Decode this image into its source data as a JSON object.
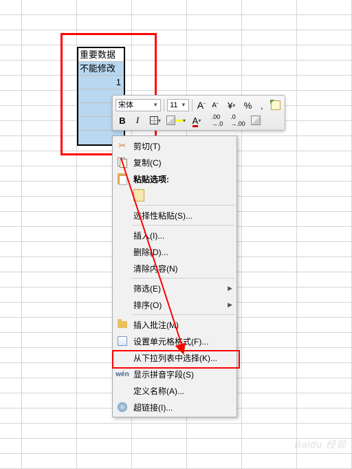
{
  "cells": {
    "r1": "重要数据",
    "r2": "不能修改",
    "r3": "1"
  },
  "toolbar": {
    "font_name": "宋体",
    "font_size": "11",
    "bold": "B",
    "italic": "I",
    "grow_font": "A",
    "shrink_font": "A",
    "percent": "%",
    "comma": ",",
    "font_color_letter": "A"
  },
  "menu": {
    "cut": "剪切(T)",
    "copy": "复制(C)",
    "paste_options": "粘贴选项:",
    "paste_special": "选择性粘贴(S)...",
    "insert": "插入(I)...",
    "delete": "删除(D)...",
    "clear": "清除内容(N)",
    "filter": "筛选(E)",
    "sort": "排序(O)",
    "insert_comment": "插入批注(M)",
    "format_cells": "设置单元格格式(F)...",
    "pick_from_list": "从下拉列表中选择(K)...",
    "show_pinyin": "显示拼音字段(S)",
    "define_name": "定义名称(A)...",
    "hyperlink": "超链接(I)..."
  },
  "watermark": "Baidu 经验"
}
